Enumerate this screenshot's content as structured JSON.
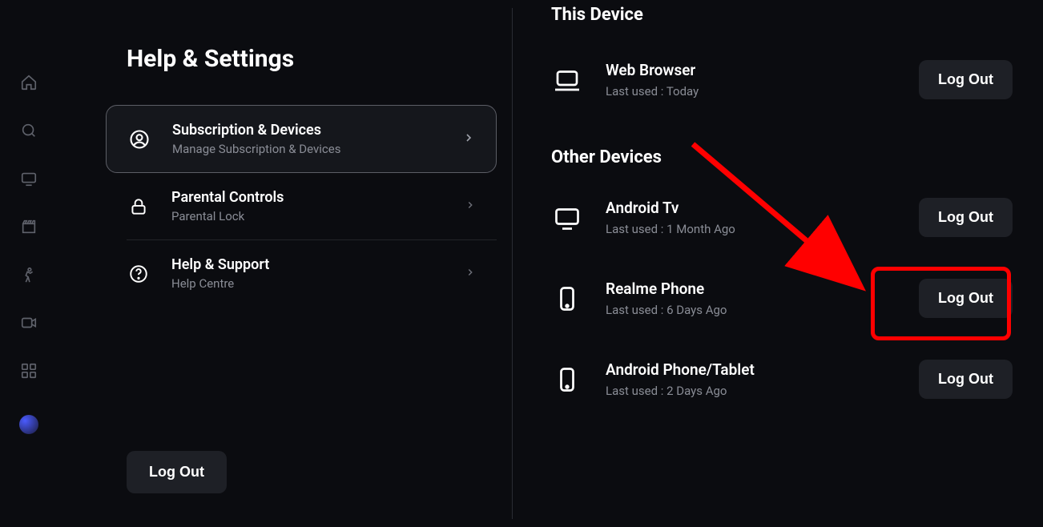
{
  "page": {
    "title": "Help & Settings",
    "logout_label": "Log Out"
  },
  "menu": {
    "subscription": {
      "title": "Subscription & Devices",
      "sub": "Manage Subscription & Devices"
    },
    "parental": {
      "title": "Parental Controls",
      "sub": "Parental Lock"
    },
    "help": {
      "title": "Help & Support",
      "sub": "Help Centre"
    }
  },
  "sections": {
    "this_device": "This Device",
    "other_devices": "Other Devices"
  },
  "logout_label": "Log Out",
  "devices": {
    "this": {
      "name": "Web Browser",
      "last": "Last used : Today"
    },
    "other": [
      {
        "name": "Android Tv",
        "last": "Last used : 1 Month Ago"
      },
      {
        "name": "Realme Phone",
        "last": "Last used : 6 Days Ago"
      },
      {
        "name": "Android Phone/Tablet",
        "last": "Last used : 2 Days Ago"
      }
    ]
  }
}
